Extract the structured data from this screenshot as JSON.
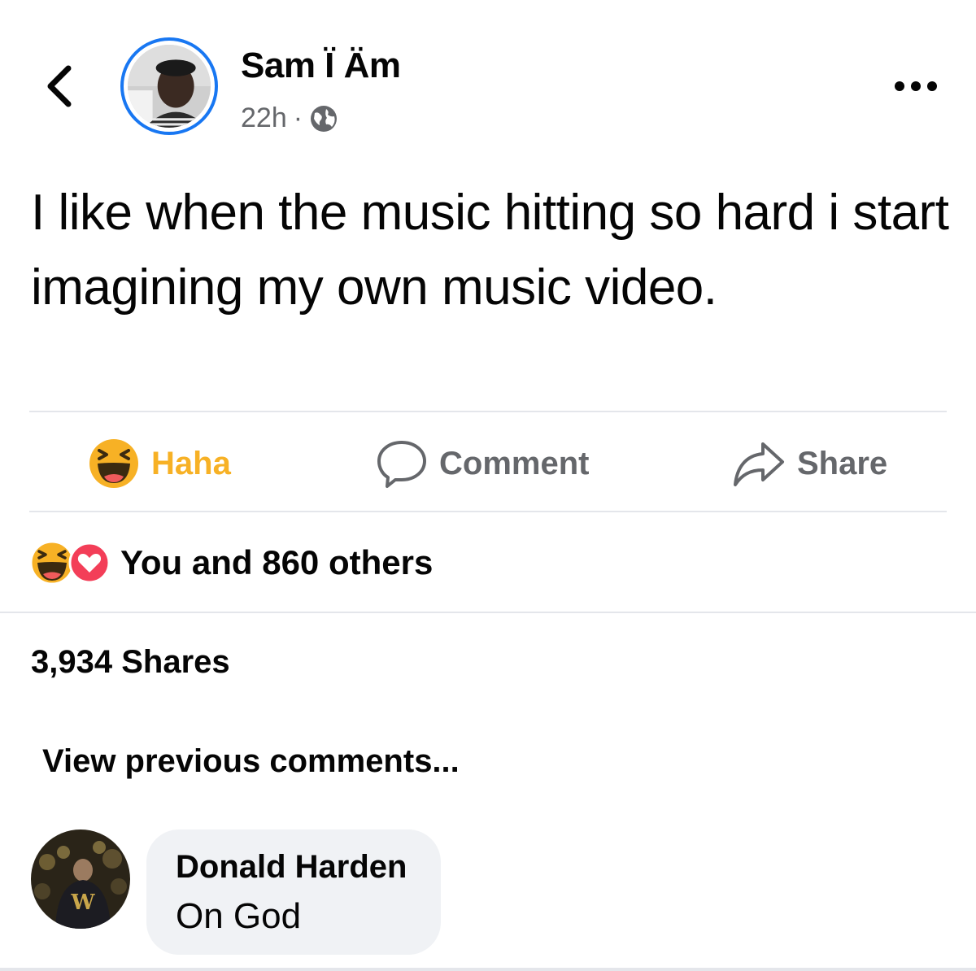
{
  "post": {
    "author": "Sam Ï Äm",
    "time": "22h",
    "separator": "·",
    "audience_icon": "globe-icon",
    "text": "I like when the music hitting so hard i start imagining my own music video."
  },
  "actions": {
    "haha_label": "Haha",
    "comment_label": "Comment",
    "share_label": "Share"
  },
  "reactions": {
    "icons": [
      "haha-icon",
      "love-icon"
    ],
    "summary": "You and 860 others"
  },
  "shares": {
    "text": "3,934 Shares"
  },
  "comments": {
    "view_previous": "View previous comments...",
    "items": [
      {
        "author": "Donald Harden",
        "text": "On God"
      }
    ]
  },
  "colors": {
    "accent_blue": "#1877f2",
    "haha_yellow": "#f7b125",
    "secondary_text": "#65676b",
    "bubble_bg": "#f0f2f5",
    "love_red": "#f33e58"
  }
}
